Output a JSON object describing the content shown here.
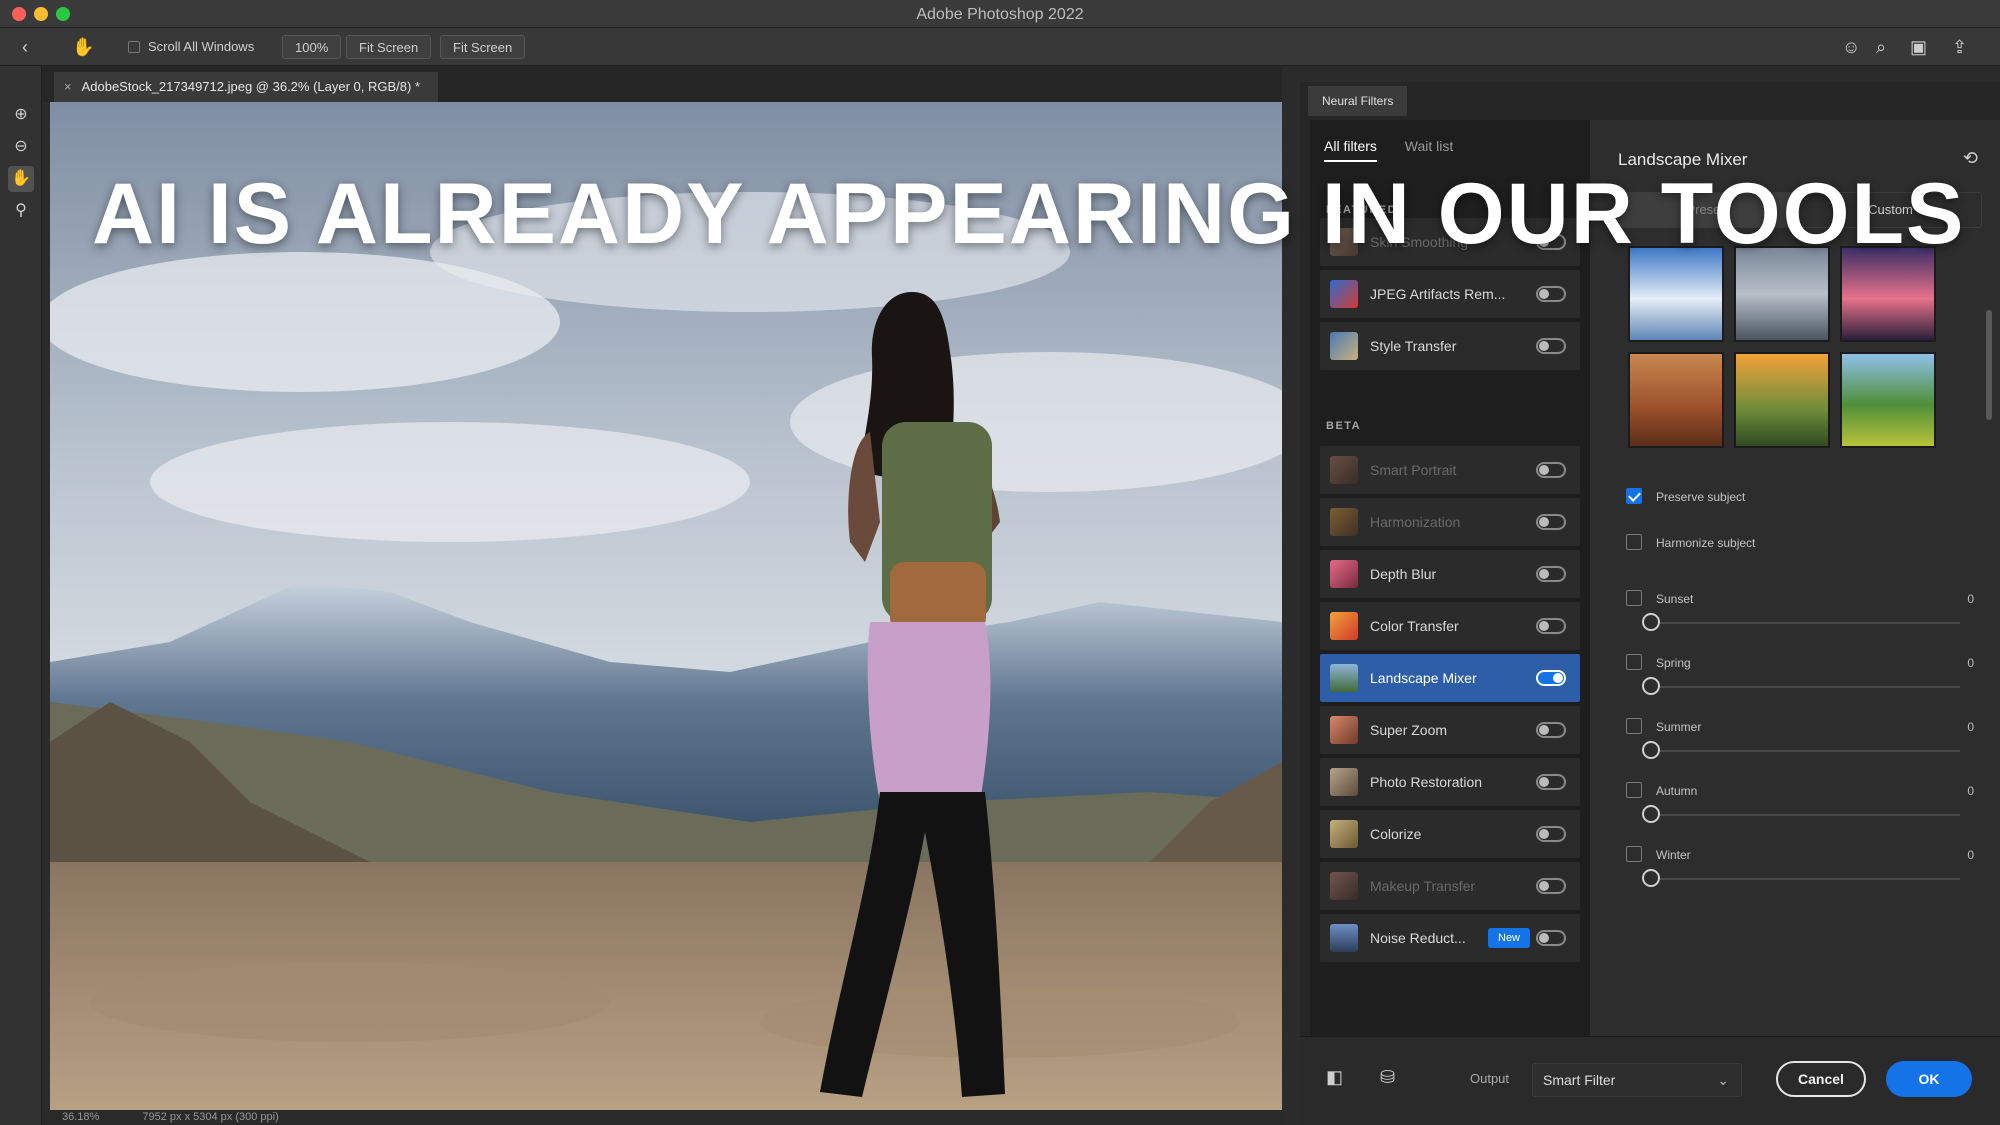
{
  "app": {
    "title": "Adobe Photoshop 2022"
  },
  "options_bar": {
    "scroll_all_windows": "Scroll All Windows",
    "zoom_100": "100%",
    "fit_screen_1": "Fit Screen",
    "fit_screen_2": "Fit Screen"
  },
  "document": {
    "tab_title": "AdobeStock_217349712.jpeg @ 36.2% (Layer 0, RGB/8) *",
    "zoom": "36.18%",
    "dimensions": "7952 px x 5304 px (300 ppi)"
  },
  "overlay": {
    "headline": "AI IS ALREADY APPEARING IN OUR TOOLS"
  },
  "neural_filters": {
    "panel_title": "Neural Filters",
    "tabs": {
      "all": "All filters",
      "wait": "Wait list"
    },
    "featured_label": "FEATURED",
    "beta_label": "BETA",
    "featured": [
      {
        "label": "Skin Smoothing",
        "dim": true
      },
      {
        "label": "JPEG Artifacts Rem...",
        "dim": false
      },
      {
        "label": "Style Transfer",
        "dim": false
      }
    ],
    "beta": [
      {
        "label": "Smart Portrait",
        "dim": true
      },
      {
        "label": "Harmonization",
        "dim": true
      },
      {
        "label": "Depth Blur",
        "dim": false
      },
      {
        "label": "Color Transfer",
        "dim": false
      },
      {
        "label": "Landscape Mixer",
        "dim": false,
        "selected": true
      },
      {
        "label": "Super Zoom",
        "dim": false
      },
      {
        "label": "Photo Restoration",
        "dim": false
      },
      {
        "label": "Colorize",
        "dim": false
      },
      {
        "label": "Makeup Transfer",
        "dim": true
      },
      {
        "label": "Noise Reduct...",
        "dim": false,
        "badge": "New"
      }
    ]
  },
  "detail": {
    "title": "Landscape Mixer",
    "seg_left": "Presets",
    "seg_right": "Custom",
    "preserve_subject": "Preserve subject",
    "harmonize_subject": "Harmonize subject",
    "sliders": [
      {
        "label": "Sunset",
        "value": "0"
      },
      {
        "label": "Spring",
        "value": "0"
      },
      {
        "label": "Summer",
        "value": "0"
      },
      {
        "label": "Autumn",
        "value": "0"
      },
      {
        "label": "Winter",
        "value": "0"
      }
    ]
  },
  "footer": {
    "output_label": "Output",
    "output_value": "Smart Filter",
    "cancel": "Cancel",
    "ok": "OK"
  },
  "colors": {
    "accent": "#1473e6",
    "panel": "#1e1e1e",
    "selected_row": "#2d5ea7"
  }
}
